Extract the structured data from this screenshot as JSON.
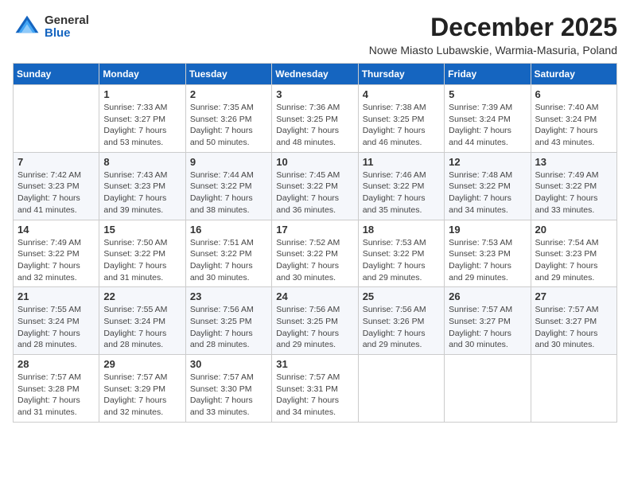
{
  "header": {
    "logo_general": "General",
    "logo_blue": "Blue",
    "month_title": "December 2025",
    "location": "Nowe Miasto Lubawskie, Warmia-Masuria, Poland"
  },
  "days_of_week": [
    "Sunday",
    "Monday",
    "Tuesday",
    "Wednesday",
    "Thursday",
    "Friday",
    "Saturday"
  ],
  "weeks": [
    [
      {
        "day": "",
        "info": ""
      },
      {
        "day": "1",
        "info": "Sunrise: 7:33 AM\nSunset: 3:27 PM\nDaylight: 7 hours\nand 53 minutes."
      },
      {
        "day": "2",
        "info": "Sunrise: 7:35 AM\nSunset: 3:26 PM\nDaylight: 7 hours\nand 50 minutes."
      },
      {
        "day": "3",
        "info": "Sunrise: 7:36 AM\nSunset: 3:25 PM\nDaylight: 7 hours\nand 48 minutes."
      },
      {
        "day": "4",
        "info": "Sunrise: 7:38 AM\nSunset: 3:25 PM\nDaylight: 7 hours\nand 46 minutes."
      },
      {
        "day": "5",
        "info": "Sunrise: 7:39 AM\nSunset: 3:24 PM\nDaylight: 7 hours\nand 44 minutes."
      },
      {
        "day": "6",
        "info": "Sunrise: 7:40 AM\nSunset: 3:24 PM\nDaylight: 7 hours\nand 43 minutes."
      }
    ],
    [
      {
        "day": "7",
        "info": "Sunrise: 7:42 AM\nSunset: 3:23 PM\nDaylight: 7 hours\nand 41 minutes."
      },
      {
        "day": "8",
        "info": "Sunrise: 7:43 AM\nSunset: 3:23 PM\nDaylight: 7 hours\nand 39 minutes."
      },
      {
        "day": "9",
        "info": "Sunrise: 7:44 AM\nSunset: 3:22 PM\nDaylight: 7 hours\nand 38 minutes."
      },
      {
        "day": "10",
        "info": "Sunrise: 7:45 AM\nSunset: 3:22 PM\nDaylight: 7 hours\nand 36 minutes."
      },
      {
        "day": "11",
        "info": "Sunrise: 7:46 AM\nSunset: 3:22 PM\nDaylight: 7 hours\nand 35 minutes."
      },
      {
        "day": "12",
        "info": "Sunrise: 7:48 AM\nSunset: 3:22 PM\nDaylight: 7 hours\nand 34 minutes."
      },
      {
        "day": "13",
        "info": "Sunrise: 7:49 AM\nSunset: 3:22 PM\nDaylight: 7 hours\nand 33 minutes."
      }
    ],
    [
      {
        "day": "14",
        "info": "Sunrise: 7:49 AM\nSunset: 3:22 PM\nDaylight: 7 hours\nand 32 minutes."
      },
      {
        "day": "15",
        "info": "Sunrise: 7:50 AM\nSunset: 3:22 PM\nDaylight: 7 hours\nand 31 minutes."
      },
      {
        "day": "16",
        "info": "Sunrise: 7:51 AM\nSunset: 3:22 PM\nDaylight: 7 hours\nand 30 minutes."
      },
      {
        "day": "17",
        "info": "Sunrise: 7:52 AM\nSunset: 3:22 PM\nDaylight: 7 hours\nand 30 minutes."
      },
      {
        "day": "18",
        "info": "Sunrise: 7:53 AM\nSunset: 3:22 PM\nDaylight: 7 hours\nand 29 minutes."
      },
      {
        "day": "19",
        "info": "Sunrise: 7:53 AM\nSunset: 3:23 PM\nDaylight: 7 hours\nand 29 minutes."
      },
      {
        "day": "20",
        "info": "Sunrise: 7:54 AM\nSunset: 3:23 PM\nDaylight: 7 hours\nand 29 minutes."
      }
    ],
    [
      {
        "day": "21",
        "info": "Sunrise: 7:55 AM\nSunset: 3:24 PM\nDaylight: 7 hours\nand 28 minutes."
      },
      {
        "day": "22",
        "info": "Sunrise: 7:55 AM\nSunset: 3:24 PM\nDaylight: 7 hours\nand 28 minutes."
      },
      {
        "day": "23",
        "info": "Sunrise: 7:56 AM\nSunset: 3:25 PM\nDaylight: 7 hours\nand 28 minutes."
      },
      {
        "day": "24",
        "info": "Sunrise: 7:56 AM\nSunset: 3:25 PM\nDaylight: 7 hours\nand 29 minutes."
      },
      {
        "day": "25",
        "info": "Sunrise: 7:56 AM\nSunset: 3:26 PM\nDaylight: 7 hours\nand 29 minutes."
      },
      {
        "day": "26",
        "info": "Sunrise: 7:57 AM\nSunset: 3:27 PM\nDaylight: 7 hours\nand 30 minutes."
      },
      {
        "day": "27",
        "info": "Sunrise: 7:57 AM\nSunset: 3:27 PM\nDaylight: 7 hours\nand 30 minutes."
      }
    ],
    [
      {
        "day": "28",
        "info": "Sunrise: 7:57 AM\nSunset: 3:28 PM\nDaylight: 7 hours\nand 31 minutes."
      },
      {
        "day": "29",
        "info": "Sunrise: 7:57 AM\nSunset: 3:29 PM\nDaylight: 7 hours\nand 32 minutes."
      },
      {
        "day": "30",
        "info": "Sunrise: 7:57 AM\nSunset: 3:30 PM\nDaylight: 7 hours\nand 33 minutes."
      },
      {
        "day": "31",
        "info": "Sunrise: 7:57 AM\nSunset: 3:31 PM\nDaylight: 7 hours\nand 34 minutes."
      },
      {
        "day": "",
        "info": ""
      },
      {
        "day": "",
        "info": ""
      },
      {
        "day": "",
        "info": ""
      }
    ]
  ]
}
